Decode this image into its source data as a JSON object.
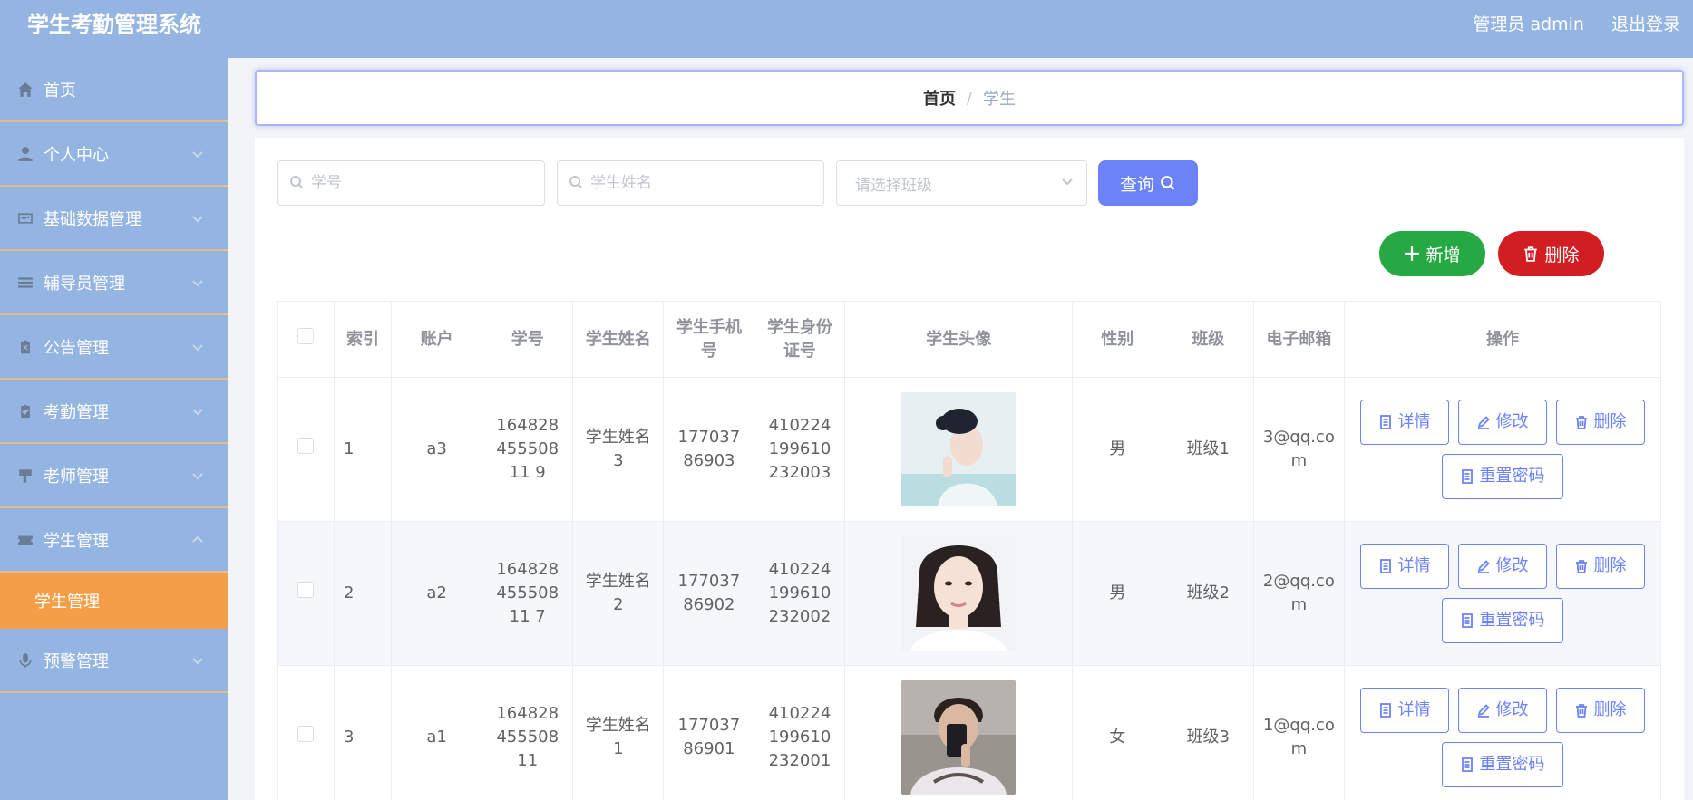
{
  "header": {
    "title": "学生考勤管理系统",
    "user": "管理员 admin",
    "logout": "退出登录"
  },
  "sidebar": {
    "items": [
      {
        "label": "首页",
        "icon": "home-icon"
      },
      {
        "label": "个人中心",
        "icon": "user-icon"
      },
      {
        "label": "基础数据管理",
        "icon": "card-icon"
      },
      {
        "label": "辅导员管理",
        "icon": "list-icon"
      },
      {
        "label": "公告管理",
        "icon": "clipboard-x-icon"
      },
      {
        "label": "考勤管理",
        "icon": "clipboard-check-icon"
      },
      {
        "label": "老师管理",
        "icon": "flag-icon"
      },
      {
        "label": "学生管理",
        "icon": "ticket-icon"
      },
      {
        "label": "预警管理",
        "icon": "microphone-icon"
      }
    ],
    "active_sub": "学生管理"
  },
  "breadcrumb": {
    "home": "首页",
    "separator": "/",
    "current": "学生"
  },
  "search": {
    "student_no_placeholder": "学号",
    "student_name_placeholder": "学生姓名",
    "class_placeholder": "请选择班级",
    "query_label": "查询"
  },
  "actions": {
    "add_label": "新增",
    "delete_label": "删除"
  },
  "table": {
    "headers": [
      "索引",
      "账户",
      "学号",
      "学生姓名",
      "学生手机号",
      "学生身份证号",
      "学生头像",
      "性别",
      "班级",
      "电子邮箱",
      "操作"
    ],
    "op_labels": {
      "detail": "详情",
      "edit": "修改",
      "delete": "删除",
      "reset": "重置密码"
    },
    "rows": [
      {
        "index": "1",
        "account": "a3",
        "student_no": "16482845550811 9",
        "name": "学生姓名3",
        "phone": "17703786903",
        "id_card": "410224199610232003",
        "gender": "男",
        "class": "班级1",
        "email": "3@qq.com"
      },
      {
        "index": "2",
        "account": "a2",
        "student_no": "16482845550811 7",
        "name": "学生姓名2",
        "phone": "17703786902",
        "id_card": "410224199610232002",
        "gender": "男",
        "class": "班级2",
        "email": "2@qq.com"
      },
      {
        "index": "3",
        "account": "a1",
        "student_no": "16482845550811",
        "name": "学生姓名1",
        "phone": "17703786901",
        "id_card": "410224199610232001",
        "gender": "女",
        "class": "班级3",
        "email": "1@qq.com"
      }
    ]
  },
  "colors": {
    "header_bg": "#94b5e1",
    "active_menu": "#f59e48",
    "primary": "#6b83f6",
    "success": "#26a842",
    "danger": "#d11e22"
  }
}
